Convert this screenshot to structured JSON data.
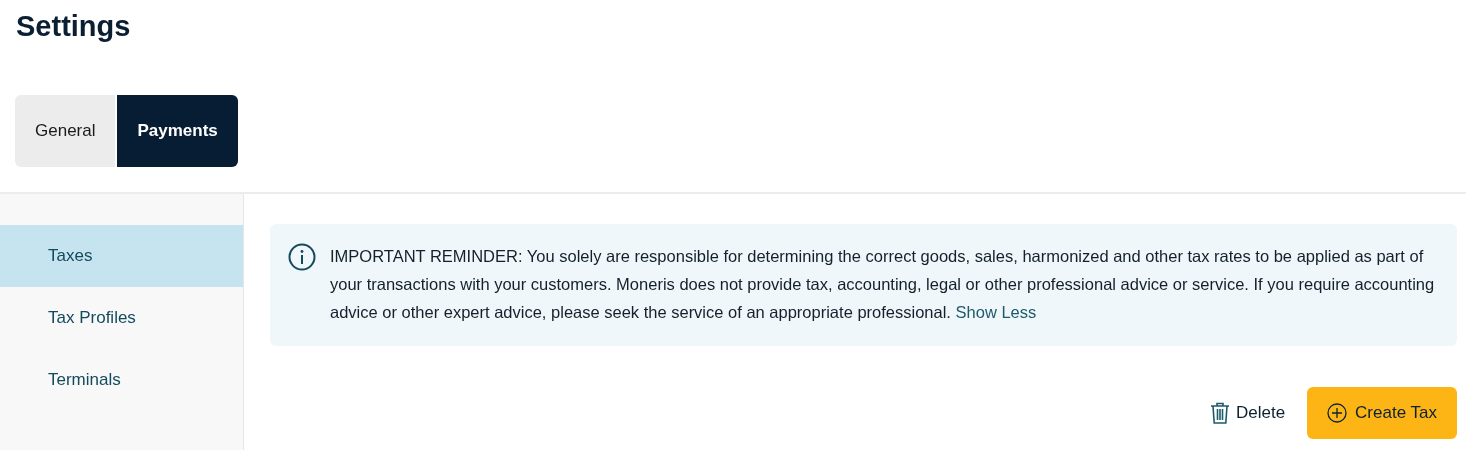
{
  "page": {
    "title": "Settings"
  },
  "tabs": [
    {
      "label": "General",
      "selected": false
    },
    {
      "label": "Payments",
      "selected": true
    }
  ],
  "sidebar": {
    "items": [
      {
        "label": "Taxes",
        "selected": true
      },
      {
        "label": "Tax Profiles",
        "selected": false
      },
      {
        "label": "Terminals",
        "selected": false
      }
    ]
  },
  "notice": {
    "text": "IMPORTANT REMINDER: You solely are responsible for determining the correct goods, sales, harmonized and other tax rates to be applied as part of your transactions with your customers. Moneris does not provide tax, accounting, legal or other professional advice or service. If you require accounting advice or other expert advice, please seek the service of an appropriate professional.",
    "link": "Show Less"
  },
  "actions": {
    "delete": "Delete",
    "create": "Create Tax"
  }
}
